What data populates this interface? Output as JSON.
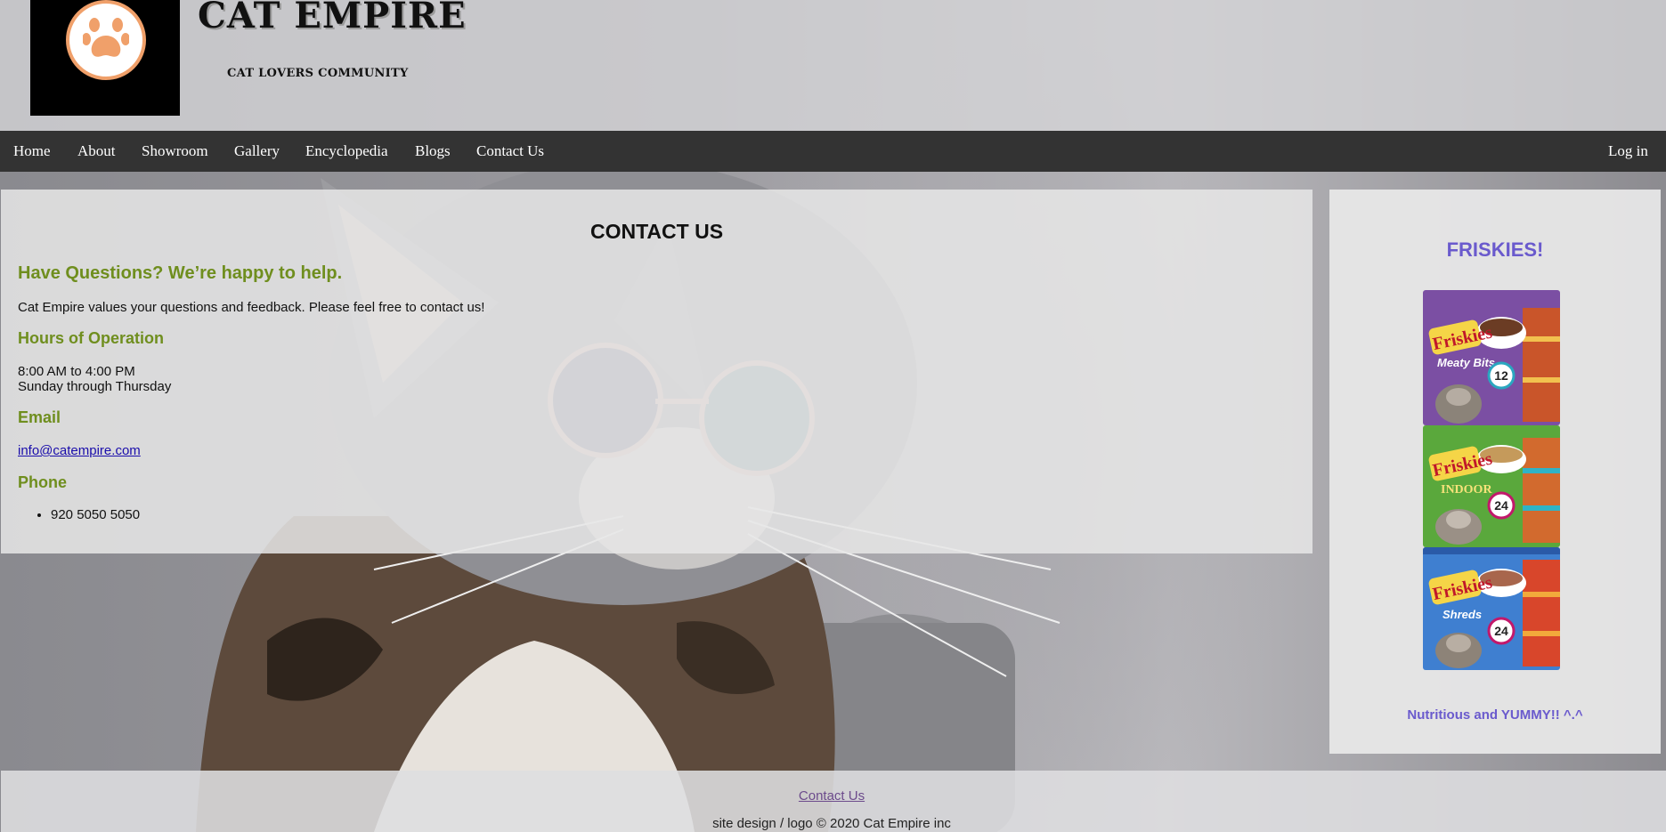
{
  "header": {
    "title": "CAT EMPIRE",
    "tagline": "CAT LOVERS COMMUNITY",
    "logo_icon": "paw-icon",
    "logo_color": "#f0a06a"
  },
  "nav": {
    "items": [
      "Home",
      "About",
      "Showroom",
      "Gallery",
      "Encyclopedia",
      "Blogs",
      "Contact Us"
    ],
    "login": "Log in"
  },
  "main": {
    "heading": "CONTACT US",
    "intro_heading": "Have Questions? We’re happy to help.",
    "intro_text": "Cat Empire values your questions and feedback. Please feel free to contact us!",
    "hours_heading": "Hours of Operation",
    "hours_time": "8:00 AM to 4:00 PM",
    "hours_days": "Sunday through Thursday",
    "email_heading": "Email",
    "email": "info@catempire.com",
    "phone_heading": "Phone",
    "phones": [
      "920 5050 5050"
    ],
    "accent_color": "#6f8e1e"
  },
  "sidebar": {
    "title": "FRISKIES!",
    "products": [
      {
        "brand": "Friskies",
        "variety": "Meaty Bits",
        "count": "12",
        "color": "#7b4fa3"
      },
      {
        "brand": "Friskies",
        "variety": "INDOOR",
        "count": "24",
        "color": "#5aa83c"
      },
      {
        "brand": "Friskies",
        "variety": "Shreds",
        "count": "24",
        "color": "#3f7fd0"
      }
    ],
    "caption": "Nutritious and YUMMY!! ^.^",
    "accent_color": "#6a5acd"
  },
  "footer": {
    "link": "Contact Us",
    "copyright": "site design / logo © 2020 Cat Empire inc"
  }
}
